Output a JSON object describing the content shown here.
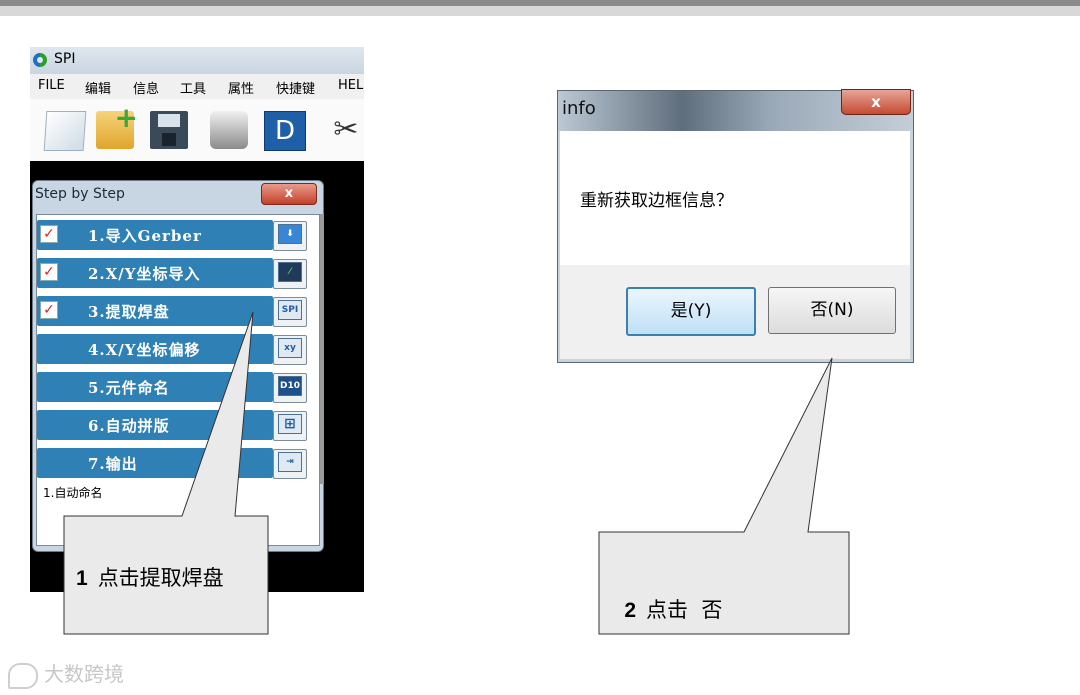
{
  "app": {
    "title": "SPI",
    "menu": [
      "FILE",
      "编辑",
      "信息",
      "工具",
      "属性",
      "快捷键",
      "HEL"
    ],
    "toolbar_icons": [
      "new-file-icon",
      "open-folder-icon",
      "save-icon",
      "database-icon",
      "d-icon",
      "scissors-icon"
    ],
    "toolbar_d_label": "D"
  },
  "panel": {
    "title": "Step by Step",
    "close_label": "x",
    "steps": [
      {
        "label": "1.导入Gerber",
        "checked": true,
        "icon": "arrow-down-icon"
      },
      {
        "label": "2.X/Y坐标导入",
        "checked": true,
        "icon": "curve-icon"
      },
      {
        "label": "3.提取焊盘",
        "checked": true,
        "icon": "spi-icon",
        "icon_text": "SPI"
      },
      {
        "label": "4.X/Y坐标偏移",
        "checked": false,
        "icon": "xy-icon",
        "icon_text": "xy"
      },
      {
        "label": "5.元件命名",
        "checked": false,
        "icon": "d10-icon",
        "icon_text": "D10"
      },
      {
        "label": "6.自动拼版",
        "checked": false,
        "icon": "grid-icon"
      },
      {
        "label": "7.输出",
        "checked": false,
        "icon": "export-icon"
      }
    ],
    "note": "1.自动命名"
  },
  "dialog": {
    "title": "info",
    "close_label": "x",
    "message": "重新获取边框信息？",
    "yes_label": "是(Y)",
    "no_label": "否(N)"
  },
  "callouts": [
    {
      "num": "1",
      "text": "点击提取焊盘"
    },
    {
      "num": "2",
      "text": "点击  否"
    }
  ],
  "watermark": "大数跨境"
}
